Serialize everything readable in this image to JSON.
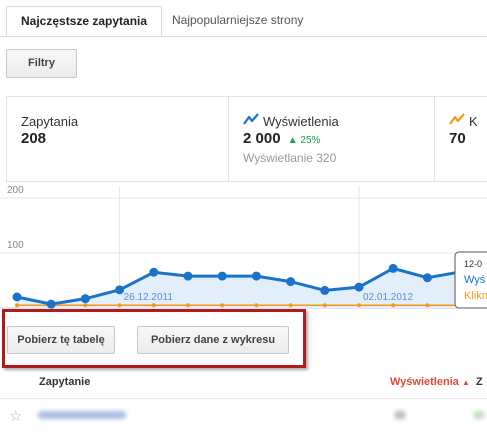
{
  "tabs": {
    "active_label": "Najczęstsze zapytania",
    "inactive_label": "Najpopularniejsze strony"
  },
  "filters_button": "Filtry",
  "metrics": {
    "queries": {
      "label": "Zapytania",
      "value": "208"
    },
    "impressions": {
      "label": "Wyświetlenia",
      "value": "2 000",
      "change": "25%",
      "sub": "Wyświetlanie 320"
    },
    "clicks": {
      "label": "K",
      "value": "70"
    }
  },
  "chart_data": {
    "type": "line",
    "ylim": [
      0,
      200
    ],
    "yticks": [
      "200",
      "100"
    ],
    "x_labels": [
      "26.12.2011",
      "02.01.2012"
    ],
    "series": [
      {
        "name": "Wyświetlenia",
        "color": "#1a73c8",
        "values": [
          20,
          7,
          17,
          33,
          65,
          58,
          58,
          58,
          48,
          32,
          38,
          72,
          55,
          66,
          66
        ]
      },
      {
        "name": "Kliknięcia",
        "color": "#f29b1a",
        "values": [
          5,
          5,
          5,
          5,
          5,
          5,
          5,
          5,
          5,
          5,
          5,
          5,
          5,
          5,
          5
        ]
      }
    ],
    "tooltip": {
      "date": "12-0",
      "line1": "Wyś",
      "line2": "Klikn"
    }
  },
  "download": {
    "table_button": "Pobierz tę tabelę",
    "chart_button": "Pobierz dane z wykresu"
  },
  "table": {
    "col_query": "Zapytanie",
    "col_impressions": "Wyświetlenia",
    "col_third": "Z"
  },
  "colors": {
    "impressions": "#1a73c8",
    "clicks": "#f29b1a",
    "highlight": "#b01c1c",
    "sort": "#dd4b39"
  }
}
